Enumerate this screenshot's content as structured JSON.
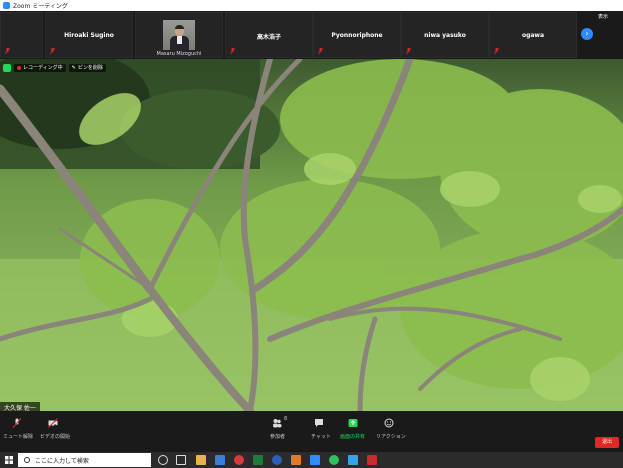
{
  "window": {
    "title": "Zoom ミーティング"
  },
  "participants_strip": {
    "tiles": [
      {
        "name": ""
      },
      {
        "name": "Hiroaki Sugino"
      },
      {
        "name": "Masaru Mizoguchi"
      },
      {
        "name": "高木浩子"
      },
      {
        "name": "Pyonnoriphone"
      },
      {
        "name": "niwa yasuko"
      },
      {
        "name": "ogawa"
      }
    ],
    "view_label": "表示",
    "next_icon": "chevron-right-icon"
  },
  "video": {
    "recording_label": "レコーディング中",
    "pin_label": "ピンを削除",
    "speaker_label": "大久保 佐一",
    "colors": {
      "recording_dot": "#e02828",
      "security_shield": "#23d959"
    }
  },
  "toolbar": {
    "mute_label": "ミュート解除",
    "video_label": "ビデオの開始",
    "participants_label": "参加者",
    "participants_count": "8",
    "chat_label": "チャット",
    "share_label": "画面の共有",
    "reactions_label": "リアクション",
    "end_label": "退出",
    "colors": {
      "end": "#e02828",
      "share": "#23d959"
    }
  },
  "taskbar": {
    "search_placeholder": "ここに入力して検索"
  }
}
